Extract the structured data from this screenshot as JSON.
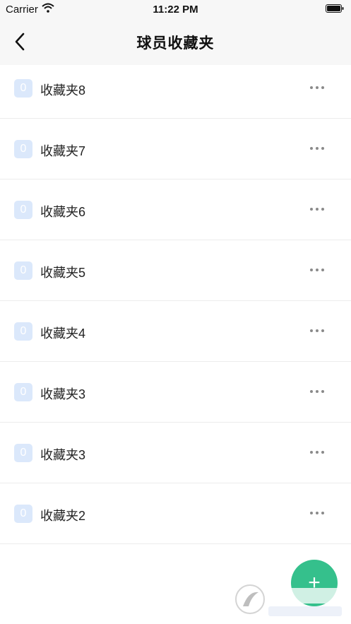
{
  "status": {
    "carrier": "Carrier",
    "time": "11:22 PM"
  },
  "nav": {
    "title": "球员收藏夹"
  },
  "folders": [
    {
      "count": "0",
      "label": "收藏夹8"
    },
    {
      "count": "0",
      "label": "收藏夹7"
    },
    {
      "count": "0",
      "label": "收藏夹6"
    },
    {
      "count": "0",
      "label": "收藏夹5"
    },
    {
      "count": "0",
      "label": "收藏夹4"
    },
    {
      "count": "0",
      "label": "收藏夹3"
    },
    {
      "count": "0",
      "label": "收藏夹3"
    },
    {
      "count": "0",
      "label": "收藏夹2"
    }
  ],
  "fab": {
    "label": "+"
  },
  "icons": {
    "back": "chevron-left-icon",
    "more": "more-horizontal-icon",
    "add": "plus-icon"
  },
  "colors": {
    "accent": "#35c08c",
    "badge": "#dbe8fb"
  }
}
